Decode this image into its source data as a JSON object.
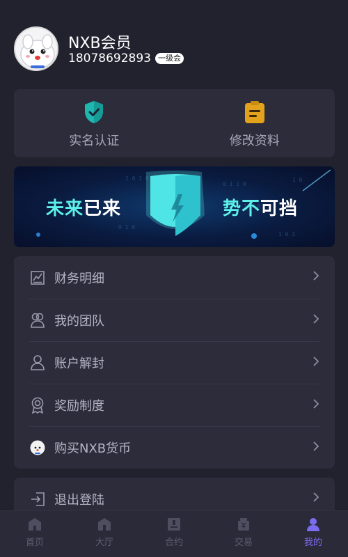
{
  "profile": {
    "username": "NXB会员",
    "phone": "18078692893",
    "level": "一级会"
  },
  "quick_actions": [
    {
      "label": "实名认证",
      "icon": "shield-check-icon"
    },
    {
      "label": "修改资料",
      "icon": "clipboard-icon"
    }
  ],
  "banner": {
    "left_text_a": "未来",
    "left_text_b": "已来",
    "right_text_a": "势不",
    "right_text_b": "可挡"
  },
  "menu": [
    {
      "label": "财务明细",
      "icon": "chart-icon"
    },
    {
      "label": "我的团队",
      "icon": "team-icon"
    },
    {
      "label": "账户解封",
      "icon": "user-icon"
    },
    {
      "label": "奖励制度",
      "icon": "medal-icon"
    },
    {
      "label": "购买NXB货币",
      "icon": "mascot-icon"
    }
  ],
  "logout": {
    "label": "退出登陆",
    "icon": "logout-icon"
  },
  "tabs": [
    {
      "label": "首页",
      "icon": "home-icon",
      "active": false
    },
    {
      "label": "大厅",
      "icon": "hall-icon",
      "active": false
    },
    {
      "label": "合约",
      "icon": "contract-icon",
      "active": false
    },
    {
      "label": "交易",
      "icon": "trade-icon",
      "active": false
    },
    {
      "label": "我的",
      "icon": "profile-icon",
      "active": true
    }
  ],
  "colors": {
    "background": "#22222f",
    "card": "#2c2c3b",
    "accent": "#7b6cf0",
    "banner_cyan": "#5ef0e8"
  }
}
